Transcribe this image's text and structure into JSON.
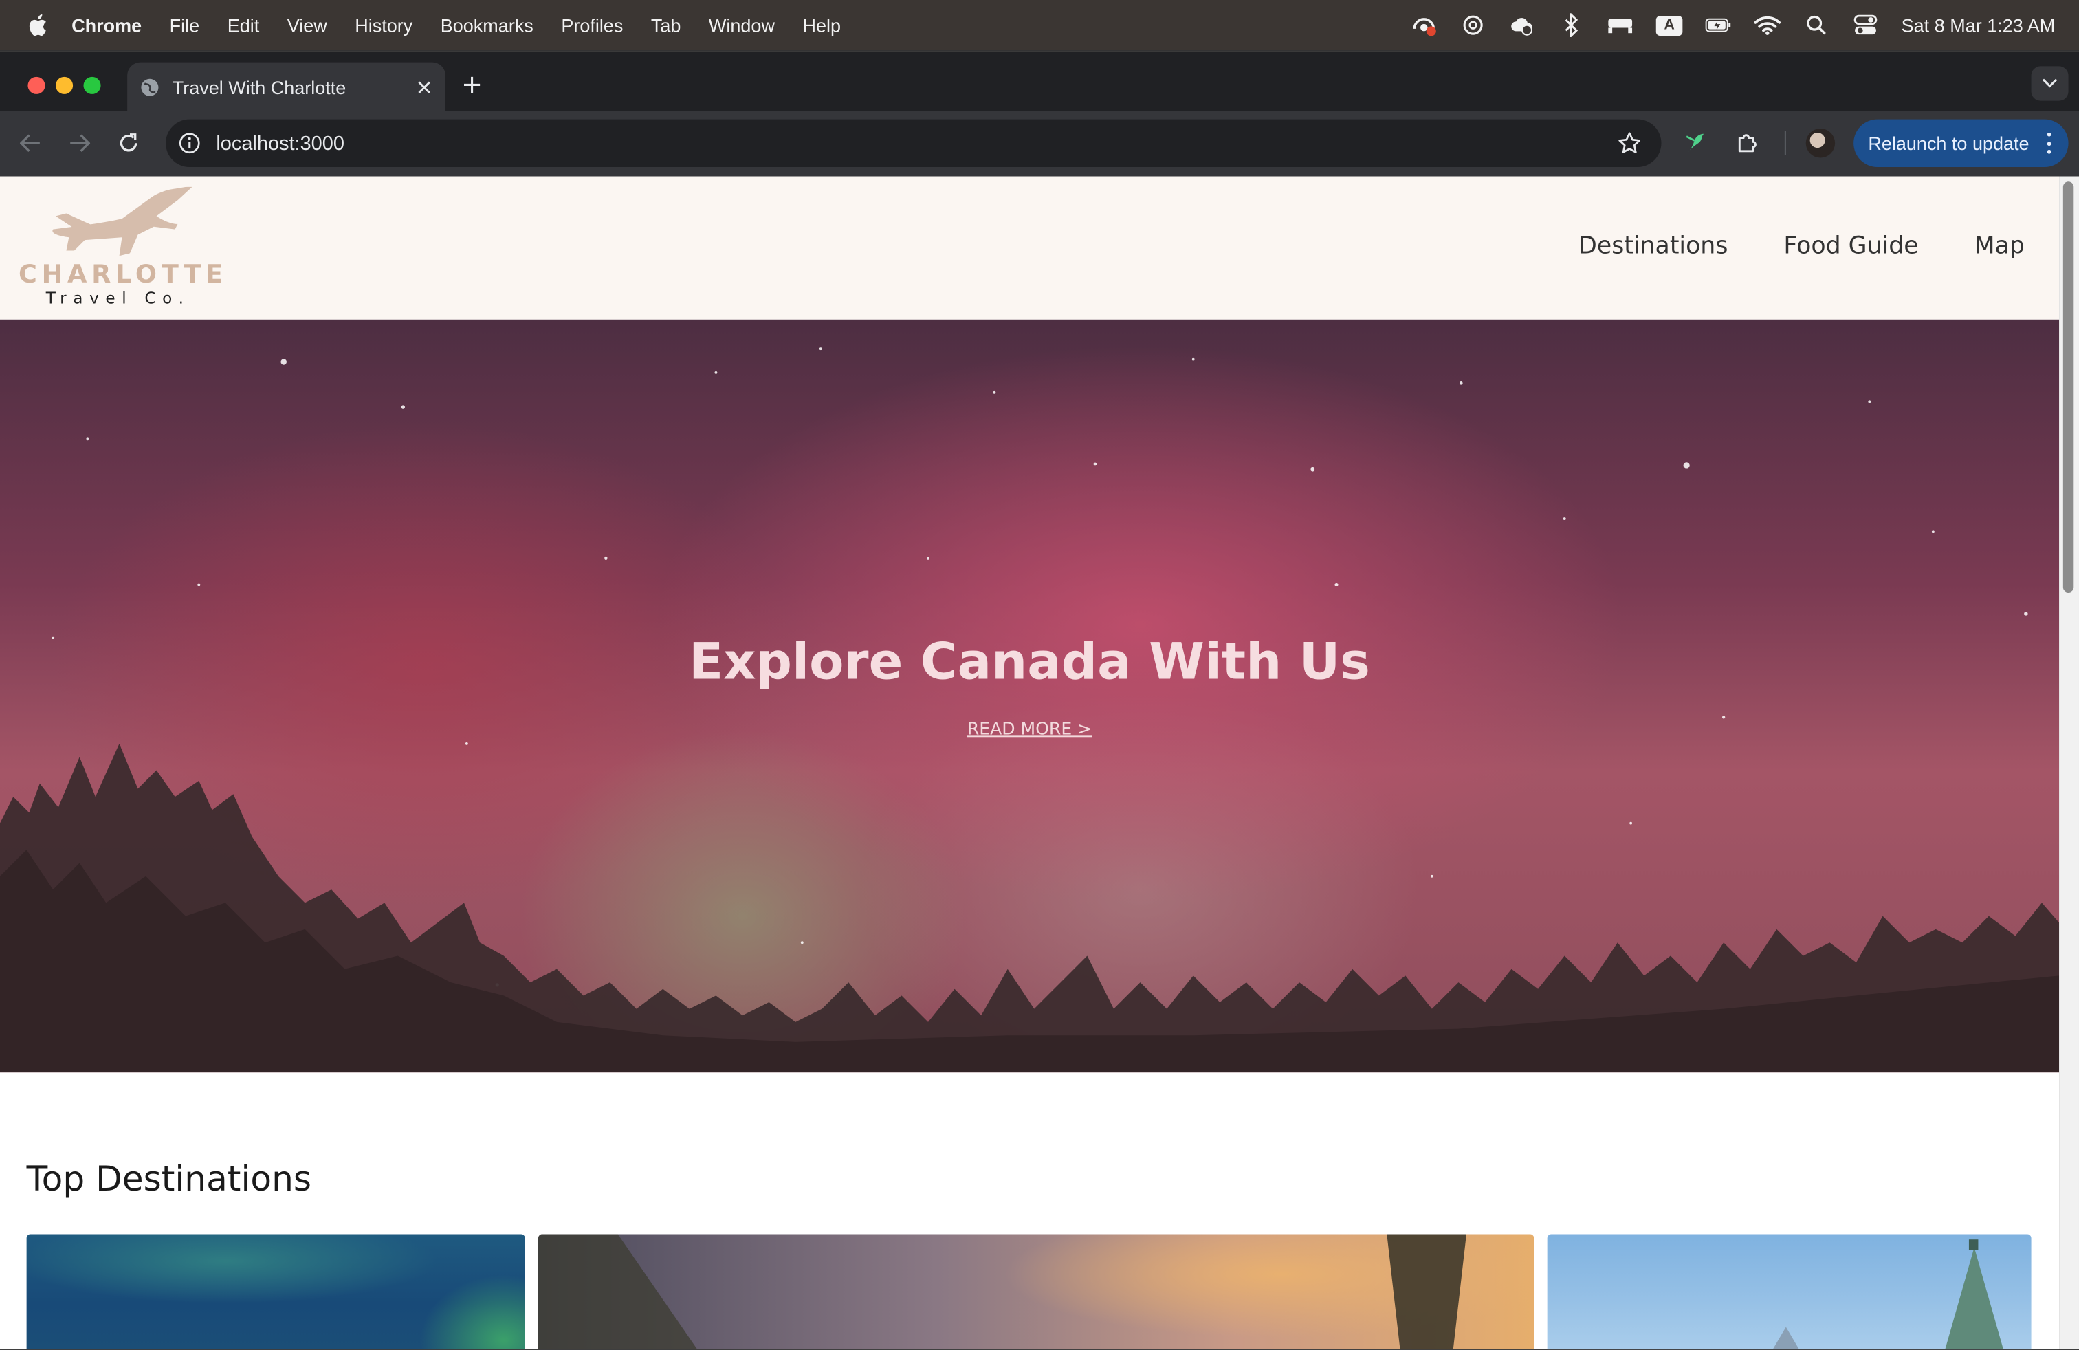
{
  "menubar": {
    "app": "Chrome",
    "items": [
      "File",
      "Edit",
      "View",
      "History",
      "Bookmarks",
      "Profiles",
      "Tab",
      "Window",
      "Help"
    ],
    "status_icons": [
      "screen-record-icon",
      "openai-icon",
      "cloud-icon",
      "bluetooth-icon",
      "bed-icon",
      "input-source-a",
      "battery-icon",
      "wifi-icon",
      "spotlight-search-icon",
      "control-center-icon"
    ],
    "input_source": "A",
    "clock": "Sat 8 Mar  1:23 AM"
  },
  "browser": {
    "tab_title": "Travel With Charlotte",
    "url": "localhost:3000",
    "relaunch_label": "Relaunch to update"
  },
  "site": {
    "logo_brand": "CHARLOTTE",
    "logo_sub": "Travel Co.",
    "nav": [
      "Destinations",
      "Food Guide",
      "Map"
    ],
    "hero_title": "Explore Canada With Us",
    "hero_link": "READ MORE >",
    "section_title": "Top Destinations"
  }
}
